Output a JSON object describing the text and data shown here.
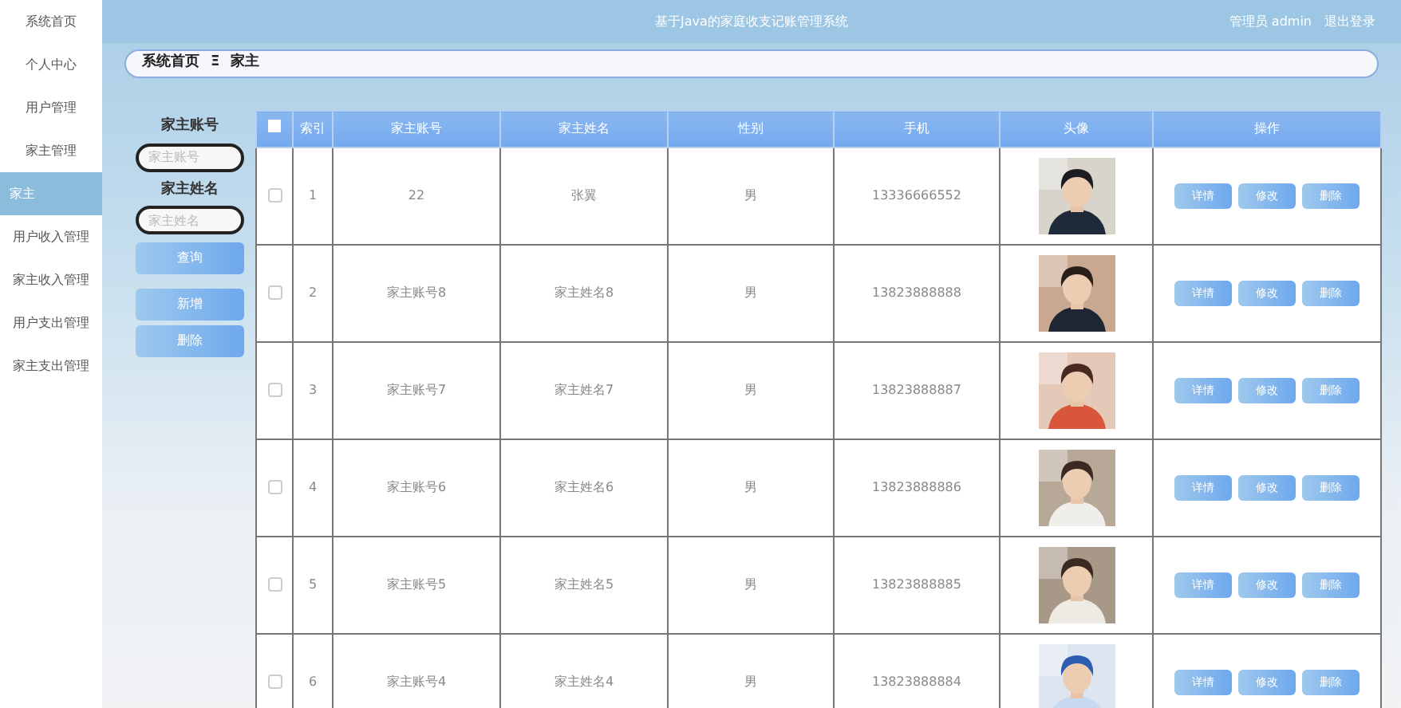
{
  "header": {
    "title": "基于Java的家庭收支记账管理系统",
    "user": "管理员 admin",
    "logout": "退出登录"
  },
  "sidebar": {
    "items": [
      {
        "label": "系统首页",
        "selected": false
      },
      {
        "label": "个人中心",
        "selected": false
      },
      {
        "label": "用户管理",
        "selected": false
      },
      {
        "label": "家主管理",
        "selected": false
      },
      {
        "label": "家主",
        "selected": true
      },
      {
        "label": "用户收入管理",
        "selected": false
      },
      {
        "label": "家主收入管理",
        "selected": false
      },
      {
        "label": "用户支出管理",
        "selected": false
      },
      {
        "label": "家主支出管理",
        "selected": false
      }
    ]
  },
  "breadcrumb": {
    "items": [
      "系统首页",
      "家主"
    ],
    "separator": "Ξ"
  },
  "filters": [
    {
      "label": "家主账号",
      "placeholder": "家主账号"
    },
    {
      "label": "家主姓名",
      "placeholder": "家主姓名"
    }
  ],
  "search_button": "查询",
  "actions": [
    "新增",
    "删除"
  ],
  "table": {
    "select_all_checked": false,
    "columns": [
      "索引",
      "家主账号",
      "家主姓名",
      "性别",
      "手机",
      "头像",
      "操作"
    ],
    "rows": [
      {
        "checked": false,
        "index": "1",
        "account": "22",
        "name": "张翼",
        "gender": "男",
        "phone": "13336666552",
        "buttons": [
          "详情",
          "修改",
          "删除"
        ]
      },
      {
        "checked": false,
        "index": "2",
        "account": "家主账号8",
        "name": "家主姓名8",
        "gender": "男",
        "phone": "13823888888",
        "buttons": [
          "详情",
          "修改",
          "删除"
        ]
      },
      {
        "checked": false,
        "index": "3",
        "account": "家主账号7",
        "name": "家主姓名7",
        "gender": "男",
        "phone": "13823888887",
        "buttons": [
          "详情",
          "修改",
          "删除"
        ]
      },
      {
        "checked": false,
        "index": "4",
        "account": "家主账号6",
        "name": "家主姓名6",
        "gender": "男",
        "phone": "13823888886",
        "buttons": [
          "详情",
          "修改",
          "删除"
        ]
      },
      {
        "checked": false,
        "index": "5",
        "account": "家主账号5",
        "name": "家主姓名5",
        "gender": "男",
        "phone": "13823888885",
        "buttons": [
          "详情",
          "修改",
          "删除"
        ]
      },
      {
        "checked": false,
        "index": "6",
        "account": "家主账号4",
        "name": "家主姓名4",
        "gender": "男",
        "phone": "13823888884",
        "buttons": [
          "详情",
          "修改",
          "删除"
        ]
      }
    ]
  }
}
